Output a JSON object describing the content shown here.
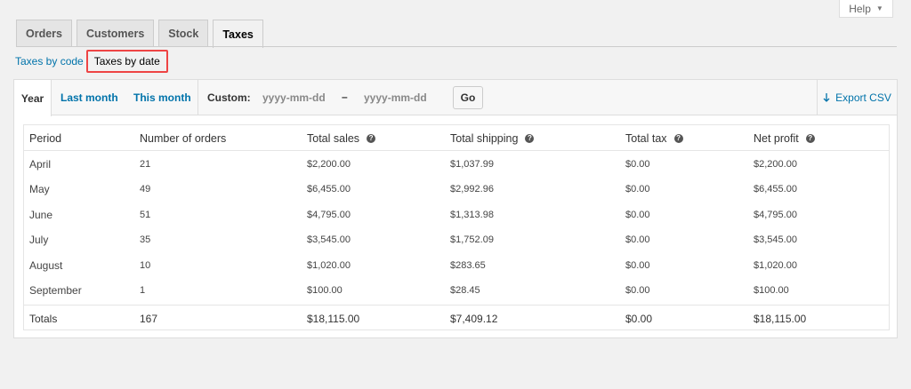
{
  "help": {
    "label": "Help"
  },
  "tabs": [
    {
      "label": "Orders",
      "active": false
    },
    {
      "label": "Customers",
      "active": false
    },
    {
      "label": "Stock",
      "active": false
    },
    {
      "label": "Taxes",
      "active": true
    }
  ],
  "subnav": {
    "by_code": "Taxes by code",
    "by_date": "Taxes by date"
  },
  "ranges": {
    "year": "Year",
    "last_month": "Last month",
    "this_month": "This month"
  },
  "custom": {
    "label": "Custom:",
    "start_placeholder": "yyyy-mm-dd",
    "separator": "–",
    "end_placeholder": "yyyy-mm-dd",
    "go": "Go"
  },
  "export": {
    "label": "Export CSV"
  },
  "table": {
    "headers": [
      "Period",
      "Number of orders",
      "Total sales",
      "Total shipping",
      "Total tax",
      "Net profit"
    ],
    "rows": [
      [
        "April",
        "21",
        "$2,200.00",
        "$1,037.99",
        "$0.00",
        "$2,200.00"
      ],
      [
        "May",
        "49",
        "$6,455.00",
        "$2,992.96",
        "$0.00",
        "$6,455.00"
      ],
      [
        "June",
        "51",
        "$4,795.00",
        "$1,313.98",
        "$0.00",
        "$4,795.00"
      ],
      [
        "July",
        "35",
        "$3,545.00",
        "$1,752.09",
        "$0.00",
        "$3,545.00"
      ],
      [
        "August",
        "10",
        "$1,020.00",
        "$283.65",
        "$0.00",
        "$1,020.00"
      ],
      [
        "September",
        "1",
        "$100.00",
        "$28.45",
        "$0.00",
        "$100.00"
      ]
    ],
    "totals": [
      "Totals",
      "167",
      "$18,115.00",
      "$7,409.12",
      "$0.00",
      "$18,115.00"
    ]
  },
  "colors": {
    "link": "#0073aa",
    "highlight_border": "#e44"
  }
}
